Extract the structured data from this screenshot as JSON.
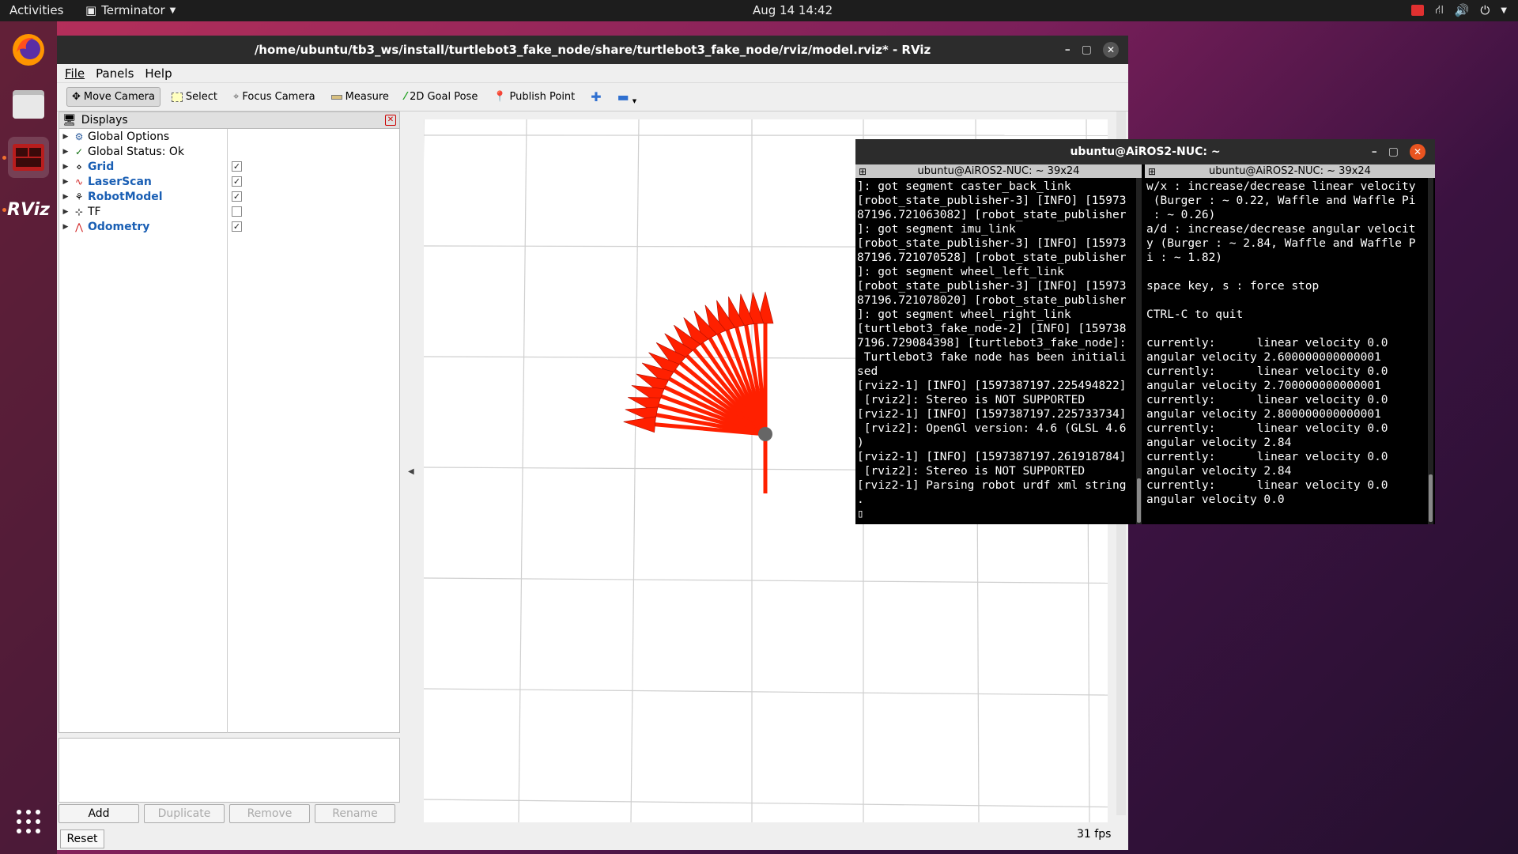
{
  "topbar": {
    "activities": "Activities",
    "app_name": "Terminator",
    "clock": "Aug 14  14:42"
  },
  "dock": {
    "items": [
      "firefox-icon",
      "files-icon",
      "terminator-icon",
      "rviz-icon",
      "app-grid-icon"
    ],
    "rviz_label": "RViz"
  },
  "rviz": {
    "title": "/home/ubuntu/tb3_ws/install/turtlebot3_fake_node/share/turtlebot3_fake_node/rviz/model.rviz* - RViz",
    "menu": [
      "File",
      "Panels",
      "Help"
    ],
    "toolbar": {
      "move_camera": "Move Camera",
      "select": "Select",
      "focus_camera": "Focus Camera",
      "measure": "Measure",
      "goal_pose": "2D Goal Pose",
      "publish_point": "Publish Point"
    },
    "displays": {
      "header": "Displays",
      "items": [
        {
          "label": "Global Options",
          "checkbox": null,
          "enabled": false
        },
        {
          "label": "Global Status: Ok",
          "checkbox": null,
          "enabled": false
        },
        {
          "label": "Grid",
          "checkbox": true,
          "enabled": true
        },
        {
          "label": "LaserScan",
          "checkbox": true,
          "enabled": true
        },
        {
          "label": "RobotModel",
          "checkbox": true,
          "enabled": true
        },
        {
          "label": "TF",
          "checkbox": false,
          "enabled": false
        },
        {
          "label": "Odometry",
          "checkbox": true,
          "enabled": true
        }
      ]
    },
    "buttons": {
      "add": "Add",
      "duplicate": "Duplicate",
      "remove": "Remove",
      "rename": "Rename",
      "reset": "Reset"
    },
    "fps": "31 fps"
  },
  "terminal": {
    "title": "ubuntu@AiROS2-NUC: ~",
    "left": {
      "header": "ubuntu@AiROS2-NUC: ~ 39x24",
      "lines": [
        "]: got segment caster_back_link",
        "[robot_state_publisher-3] [INFO] [15973",
        "87196.721063082] [robot_state_publisher",
        "]: got segment imu_link",
        "[robot_state_publisher-3] [INFO] [15973",
        "87196.721070528] [robot_state_publisher",
        "]: got segment wheel_left_link",
        "[robot_state_publisher-3] [INFO] [15973",
        "87196.721078020] [robot_state_publisher",
        "]: got segment wheel_right_link",
        "[turtlebot3_fake_node-2] [INFO] [159738",
        "7196.729084398] [turtlebot3_fake_node]:",
        " Turtlebot3 fake node has been initiali",
        "sed",
        "[rviz2-1] [INFO] [1597387197.225494822]",
        " [rviz2]: Stereo is NOT SUPPORTED",
        "[rviz2-1] [INFO] [1597387197.225733734]",
        " [rviz2]: OpenGl version: 4.6 (GLSL 4.6",
        ")",
        "[rviz2-1] [INFO] [1597387197.261918784]",
        " [rviz2]: Stereo is NOT SUPPORTED",
        "[rviz2-1] Parsing robot urdf xml string",
        ".",
        "▯"
      ]
    },
    "right": {
      "header": "ubuntu@AiROS2-NUC: ~ 39x24",
      "lines": [
        "w/x : increase/decrease linear velocity",
        " (Burger : ~ 0.22, Waffle and Waffle Pi",
        " : ~ 0.26)",
        "a/d : increase/decrease angular velocit",
        "y (Burger : ~ 2.84, Waffle and Waffle P",
        "i : ~ 1.82)",
        "",
        "space key, s : force stop",
        "",
        "CTRL-C to quit",
        "",
        "currently:      linear velocity 0.0",
        "angular velocity 2.600000000000001",
        "currently:      linear velocity 0.0",
        "angular velocity 2.700000000000001",
        "currently:      linear velocity 0.0",
        "angular velocity 2.800000000000001",
        "currently:      linear velocity 0.0",
        "angular velocity 2.84",
        "currently:      linear velocity 0.0",
        "angular velocity 2.84",
        "currently:      linear velocity 0.0",
        "angular velocity 0.0"
      ]
    }
  },
  "colors": {
    "odometry_arrow": "#ff2000",
    "accent_orange": "#e95420"
  }
}
